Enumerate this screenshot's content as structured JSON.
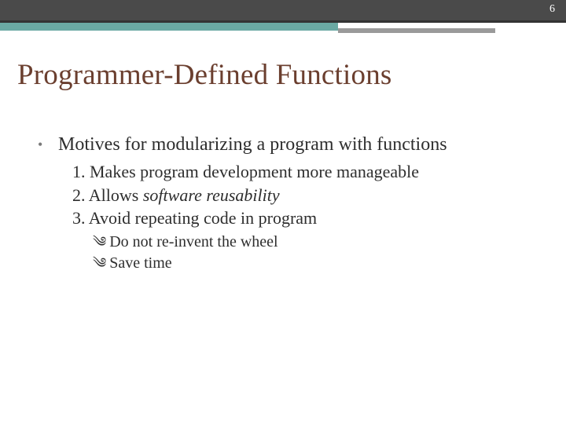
{
  "page_number": "6",
  "title": "Programmer-Defined Functions",
  "bullet": {
    "text": "Motives for modularizing a program with functions"
  },
  "numbered": {
    "item1": "1.  Makes program development more manageable",
    "item2_prefix": "2. Allows ",
    "item2_emph": "software reusability",
    "item3": "3. Avoid repeating code in program"
  },
  "sub": {
    "glyph": "༄",
    "s1": "Do not re-invent the wheel",
    "s2": "Save time"
  }
}
